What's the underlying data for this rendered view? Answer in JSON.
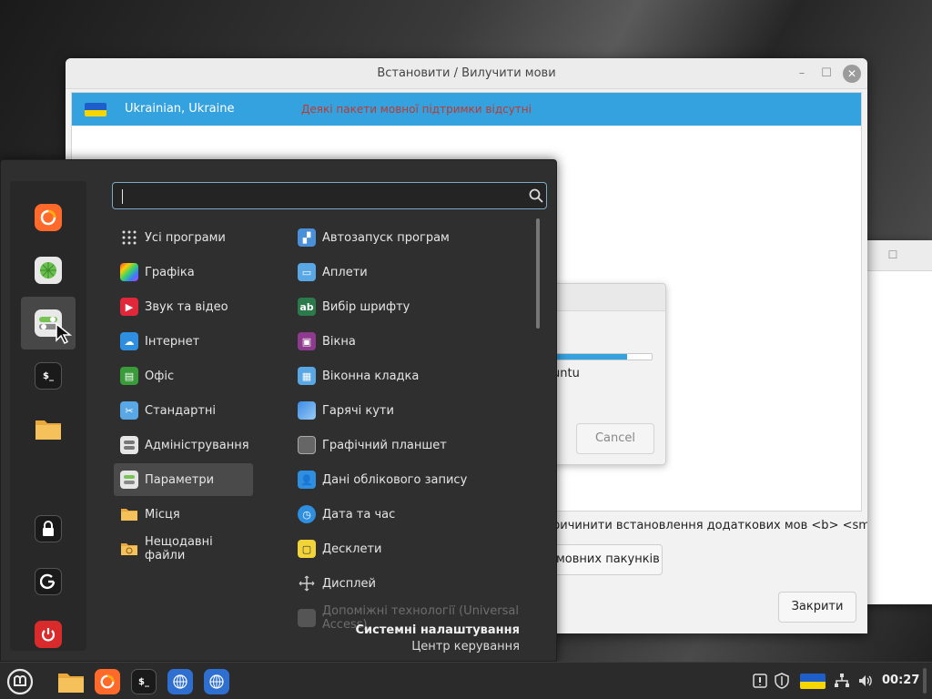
{
  "window": {
    "title": "Встановити / Вилучити мови",
    "languages": [
      {
        "name": "Ukrainian, Ukraine",
        "status": "Деякі пакети мовної підтримки відсутні"
      }
    ],
    "hint_text": "ричинити встановлення додаткових мов <b> <small>",
    "packages_button": "мовних пакунків",
    "close_button": "Закрити"
  },
  "progress_dialog": {
    "text": "untu",
    "cancel_button": "Cancel",
    "progress": 0.78
  },
  "menu": {
    "search": {
      "value": "",
      "placeholder": ""
    },
    "favorites": [
      "firefox-icon",
      "network-icon",
      "settings-icon",
      "terminal-icon",
      "folder-icon",
      "lock-icon",
      "logout-icon",
      "power-icon"
    ],
    "categories": [
      {
        "label": "Усі програми",
        "icon": "grid-icon"
      },
      {
        "label": "Графіка",
        "icon": "graphics-icon"
      },
      {
        "label": "Звук та відео",
        "icon": "media-icon"
      },
      {
        "label": "Інтернет",
        "icon": "internet-icon"
      },
      {
        "label": "Офіс",
        "icon": "office-icon"
      },
      {
        "label": "Стандартні",
        "icon": "accessories-icon"
      },
      {
        "label": "Адміністрування",
        "icon": "admin-icon"
      },
      {
        "label": "Параметри",
        "icon": "preferences-icon"
      },
      {
        "label": "Місця",
        "icon": "folder-icon"
      },
      {
        "label": "Нещодавні файли",
        "icon": "recent-folder-icon"
      }
    ],
    "apps": [
      {
        "label": "Автозапуск програм",
        "icon": "autostart-icon"
      },
      {
        "label": "Аплети",
        "icon": "applets-icon"
      },
      {
        "label": "Вибір шрифту",
        "icon": "font-icon"
      },
      {
        "label": "Вікна",
        "icon": "windows-icon"
      },
      {
        "label": "Віконна кладка",
        "icon": "tiling-icon"
      },
      {
        "label": "Гарячі кути",
        "icon": "hotcorner-icon"
      },
      {
        "label": "Графічний планшет",
        "icon": "tablet-icon"
      },
      {
        "label": "Дані облікового запису",
        "icon": "account-icon"
      },
      {
        "label": "Дата та час",
        "icon": "clock-icon"
      },
      {
        "label": "Десклети",
        "icon": "desklets-icon"
      },
      {
        "label": "Дисплей",
        "icon": "display-icon"
      },
      {
        "label": "Допоміжні технології (Universal Access)",
        "icon": "accessibility-icon"
      }
    ],
    "footer_title": "Системні налаштування",
    "footer_subtitle": "Центр керування"
  },
  "taskbar": {
    "clock": "00:27",
    "colors": {
      "accent": "#35a2e0",
      "menu_bg": "#2f2f2f",
      "taskbar_bg": "#2b2b2b"
    }
  }
}
